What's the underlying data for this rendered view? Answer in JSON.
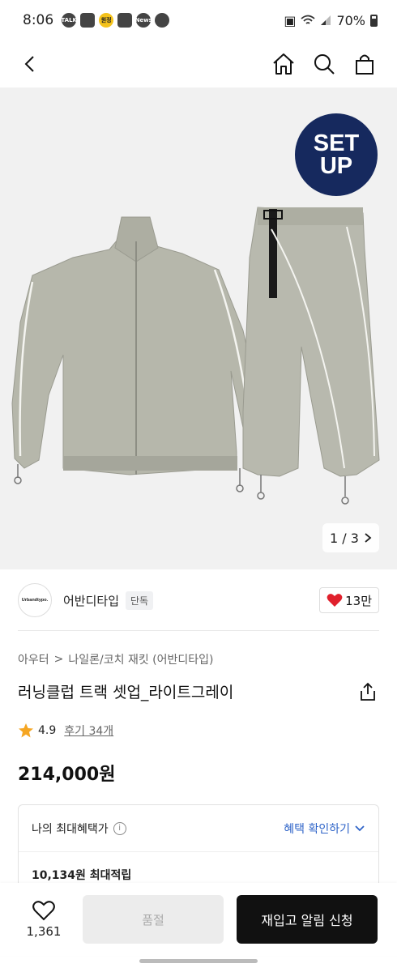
{
  "status_bar": {
    "time": "8:06",
    "notification_icons": [
      "talk-icon",
      "instagram-icon",
      "yellow-badge-icon",
      "map-pin-icon",
      "app-icon",
      "cloud-icon"
    ],
    "notif_talk": "TALK",
    "notif_yellow": "원정",
    "notif_app": "News",
    "battery": "70%"
  },
  "product": {
    "badge_line1": "SET",
    "badge_line2": "UP",
    "image_index": "1 / 3",
    "brand_logo_text": "Urbandtypo.",
    "brand_name": "어반디타입",
    "brand_tag": "단독",
    "likes": "13만",
    "breadcrumb": [
      "아우터",
      "나일론/코치 재킷 (어반디타입)"
    ],
    "title": "러닝클럽 트랙 셋업_라이트그레이",
    "rating": "4.9",
    "reviews": "후기 34개",
    "price": "214,000원"
  },
  "benefit": {
    "label": "나의 최대혜택가",
    "link": "혜택 확인하기",
    "sub": "10,134원 최대적립"
  },
  "bottom": {
    "wish_count": "1,361",
    "sold_out": "품절",
    "notify": "재입고 알림 신청"
  },
  "colors": {
    "badge_bg": "#16295e",
    "heart": "#e0202c",
    "link": "#2f64c8",
    "cta_bg": "#111111",
    "garment": "#b8b9ae"
  }
}
